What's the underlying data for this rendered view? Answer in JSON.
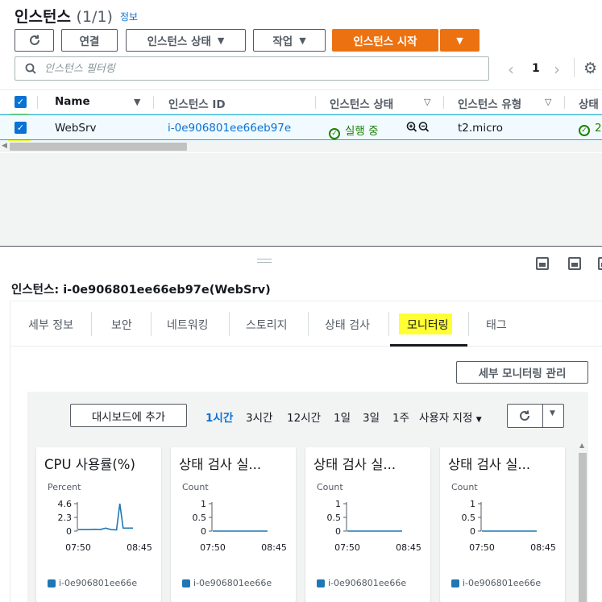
{
  "header": {
    "title": "인스턴스",
    "count": "(1/1)",
    "info": "정보"
  },
  "toolbar": {
    "connect": "연결",
    "instance_state": "인스턴스 상태",
    "actions": "작업",
    "launch": "인스턴스 시작"
  },
  "filter": {
    "placeholder": "인스턴스 필터링"
  },
  "pagination": {
    "page": "1"
  },
  "table": {
    "columns": [
      "Name",
      "인스턴스 ID",
      "인스턴스 상태",
      "인스턴스 유형",
      "상태"
    ],
    "rows": [
      {
        "name": "WebSrv",
        "id": "i-0e906801ee66eb97e",
        "state": "실행 중",
        "type": "t2.micro",
        "status": "2"
      }
    ]
  },
  "detail": {
    "title": "인스턴스: i-0e906801ee66eb97e(WebSrv)",
    "tabs": [
      "세부 정보",
      "보안",
      "네트워킹",
      "스토리지",
      "상태 검사",
      "모니터링",
      "태그"
    ],
    "active_tab": "모니터링",
    "manage_monitoring": "세부 모니터링 관리"
  },
  "monitoring": {
    "add_dashboard": "대시보드에 추가",
    "ranges": [
      "1시간",
      "3시간",
      "12시간",
      "1일",
      "3일",
      "1주",
      "사용자 지정"
    ],
    "active_range": "1시간"
  },
  "chart_data": [
    {
      "type": "line",
      "title": "CPU 사용률(%)",
      "ylabel": "Percent",
      "yticks": [
        "4.6",
        "2.3",
        "0"
      ],
      "ylim": [
        0,
        4.6
      ],
      "xticks": [
        "07:50",
        "08:45"
      ],
      "series": [
        {
          "name": "i-0e906801ee66e",
          "x": [
            0,
            0.1,
            0.2,
            0.3,
            0.4,
            0.5,
            0.6,
            0.7,
            0.76,
            0.82,
            0.9,
            1.0
          ],
          "values": [
            0.25,
            0.25,
            0.25,
            0.3,
            0.25,
            0.5,
            0.25,
            0.2,
            4.6,
            0.5,
            0.5,
            0.5
          ]
        }
      ]
    },
    {
      "type": "line",
      "title": "상태 검사 실...",
      "ylabel": "Count",
      "yticks": [
        "1",
        "0.5",
        "0"
      ],
      "ylim": [
        0,
        1
      ],
      "xticks": [
        "07:50",
        "08:45"
      ],
      "series": [
        {
          "name": "i-0e906801ee66e",
          "x": [
            0,
            1
          ],
          "values": [
            0,
            0
          ]
        }
      ]
    },
    {
      "type": "line",
      "title": "상태 검사 실...",
      "ylabel": "Count",
      "yticks": [
        "1",
        "0.5",
        "0"
      ],
      "ylim": [
        0,
        1
      ],
      "xticks": [
        "07:50",
        "08:45"
      ],
      "series": [
        {
          "name": "i-0e906801ee66e",
          "x": [
            0,
            1
          ],
          "values": [
            0,
            0
          ]
        }
      ]
    },
    {
      "type": "line",
      "title": "상태 검사 실...",
      "ylabel": "Count",
      "yticks": [
        "1",
        "0.5",
        "0"
      ],
      "ylim": [
        0,
        1
      ],
      "xticks": [
        "07:50",
        "08:45"
      ],
      "series": [
        {
          "name": "i-0e906801ee66e",
          "x": [
            0,
            1
          ],
          "values": [
            0,
            0
          ]
        }
      ]
    }
  ],
  "colors": {
    "accent": "#ec7211",
    "link": "#0972d3",
    "running": "#1d8102",
    "series": "#1f77b4",
    "highlight": "#ffff33"
  }
}
